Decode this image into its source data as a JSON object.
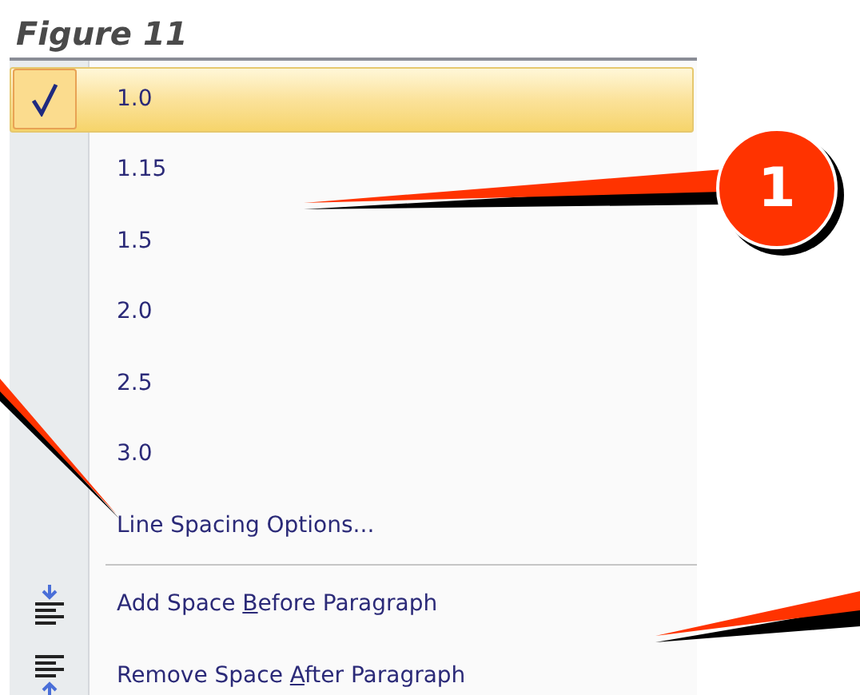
{
  "figure_title": "Figure 11",
  "menu": {
    "items": [
      {
        "kind": "option",
        "label": "1.0",
        "checked": true,
        "highlighted": true
      },
      {
        "kind": "option",
        "label": "1.15",
        "checked": false,
        "highlighted": false
      },
      {
        "kind": "option",
        "label": "1.5",
        "checked": false,
        "highlighted": false
      },
      {
        "kind": "option",
        "label": "2.0",
        "checked": false,
        "highlighted": false
      },
      {
        "kind": "option",
        "label": "2.5",
        "checked": false,
        "highlighted": false
      },
      {
        "kind": "option",
        "label": "3.0",
        "checked": false,
        "highlighted": false
      },
      {
        "kind": "command",
        "label": "Line Spacing Options..."
      },
      {
        "kind": "separator"
      },
      {
        "kind": "space_before",
        "label_before": "Add Space ",
        "access_key": "B",
        "label_after": "efore Paragraph"
      },
      {
        "kind": "space_after",
        "label_before": "Remove Space ",
        "access_key": "A",
        "label_after": "fter Paragraph"
      }
    ]
  },
  "callouts": [
    {
      "number": "1"
    }
  ]
}
